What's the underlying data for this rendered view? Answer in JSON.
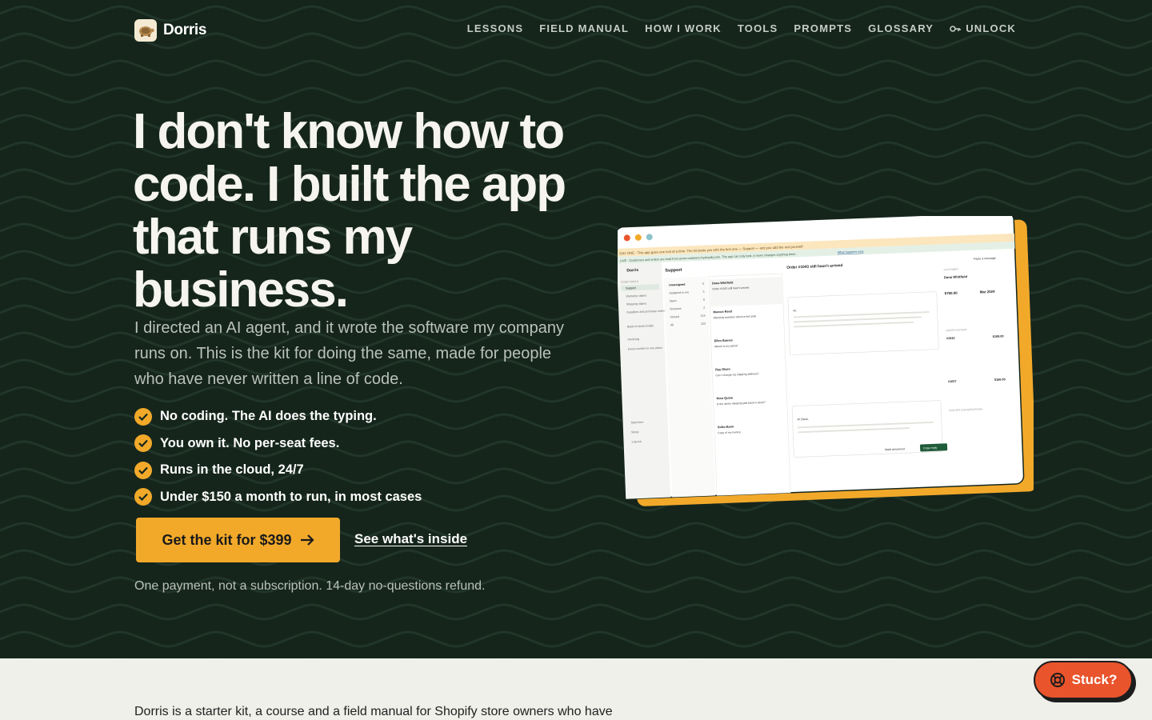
{
  "brand": {
    "name": "Dorris"
  },
  "nav": {
    "links": [
      "LESSONS",
      "FIELD MANUAL",
      "HOW I WORK",
      "TOOLS",
      "PROMPTS",
      "GLOSSARY"
    ],
    "unlock": "UNLOCK"
  },
  "hero": {
    "headline": "I don't know how to code. I built the app that runs my business.",
    "subhead": "I directed an AI agent, and it wrote the software my company runs on. This is the kit for doing the same, made for people who have never written a line of code.",
    "checks": [
      "No coding. The AI does the typing.",
      "You own it. No per-seat fees.",
      "Runs in the cloud, 24/7",
      "Under $150 a month to run, in most cases"
    ],
    "cta_label": "Get the kit for $399",
    "secondary_link": "See what's inside",
    "note": "One payment, not a subscription. 14-day no-questions refund."
  },
  "below": {
    "intro": "Dorris is a starter kit, a course and a field manual for Shopify store owners who have"
  },
  "help": {
    "label": "Stuck?"
  },
  "colors": {
    "hero_bg": "#15251c",
    "accent": "#f2a92a",
    "help_bg": "#e9542c",
    "page_bg": "#eef0e9"
  },
  "screenshot": {
    "banner": "DAY ONE · This app goes one tool at a time. The kit starts you with the first one — Support — and you add the rest yourself",
    "live": "LIVE · Customers and orders are read from acme-outdoors.myshopify.com. The app can only look, it never changes anything there.",
    "live_link": "What happens next",
    "sidebar_brand": "Dorris",
    "sidebar_section": "YOUR TOOLS",
    "sidebar_items": [
      "Support",
      "Warranty claims",
      "Shipping claims",
      "Suppliers and purchase orders",
      "Back-in-stock emails",
      "Invoicing",
      "Every number in one place"
    ],
    "sidebar_footer": [
      "Start here",
      "Setup",
      "Log out"
    ],
    "main_title": "Support",
    "views": [
      "Unassigned",
      "Assigned to me",
      "Open",
      "Snoozed",
      "Closed",
      "All"
    ],
    "view_counts": [
      "5",
      "3",
      "9",
      "2",
      "214",
      "233"
    ],
    "tickets": [
      {
        "name": "Dana Whitfield",
        "subject": "Order #1043 still hasn't arrived"
      },
      {
        "name": "Marcus Reed",
        "subject": "Warranty question about a tent pole"
      },
      {
        "name": "Ellen Barnes",
        "subject": "Where is my parcel"
      },
      {
        "name": "Ray Olsen",
        "subject": "Can I change my shipping address?"
      },
      {
        "name": "Nora Quinn",
        "subject": "Is the winter sleeping pad back in stock?"
      },
      {
        "name": "Sofia Marin",
        "subject": "Copy of my invoice"
      }
    ],
    "detail_title": "Order #1043 still hasn't arrived",
    "detail_greeting": "Hi,",
    "reply_opening": "Hi Dana,",
    "copy_reply": "Copy reply",
    "mark_answered": "Mark answered",
    "customer_name": "Dana Whitfield",
    "customer_total": "$780.00",
    "customer_since": "Mar 2024",
    "order_1": "#1043",
    "order_1_total": "$189.00",
    "order_2": "#1027",
    "order_2_total": "$156.00",
    "paste": "Paste a message",
    "panel_customer": "CUSTOMER",
    "panel_history": "ORDER HISTORY",
    "panel_earlier": "EARLIER CONVERSATIONS"
  }
}
